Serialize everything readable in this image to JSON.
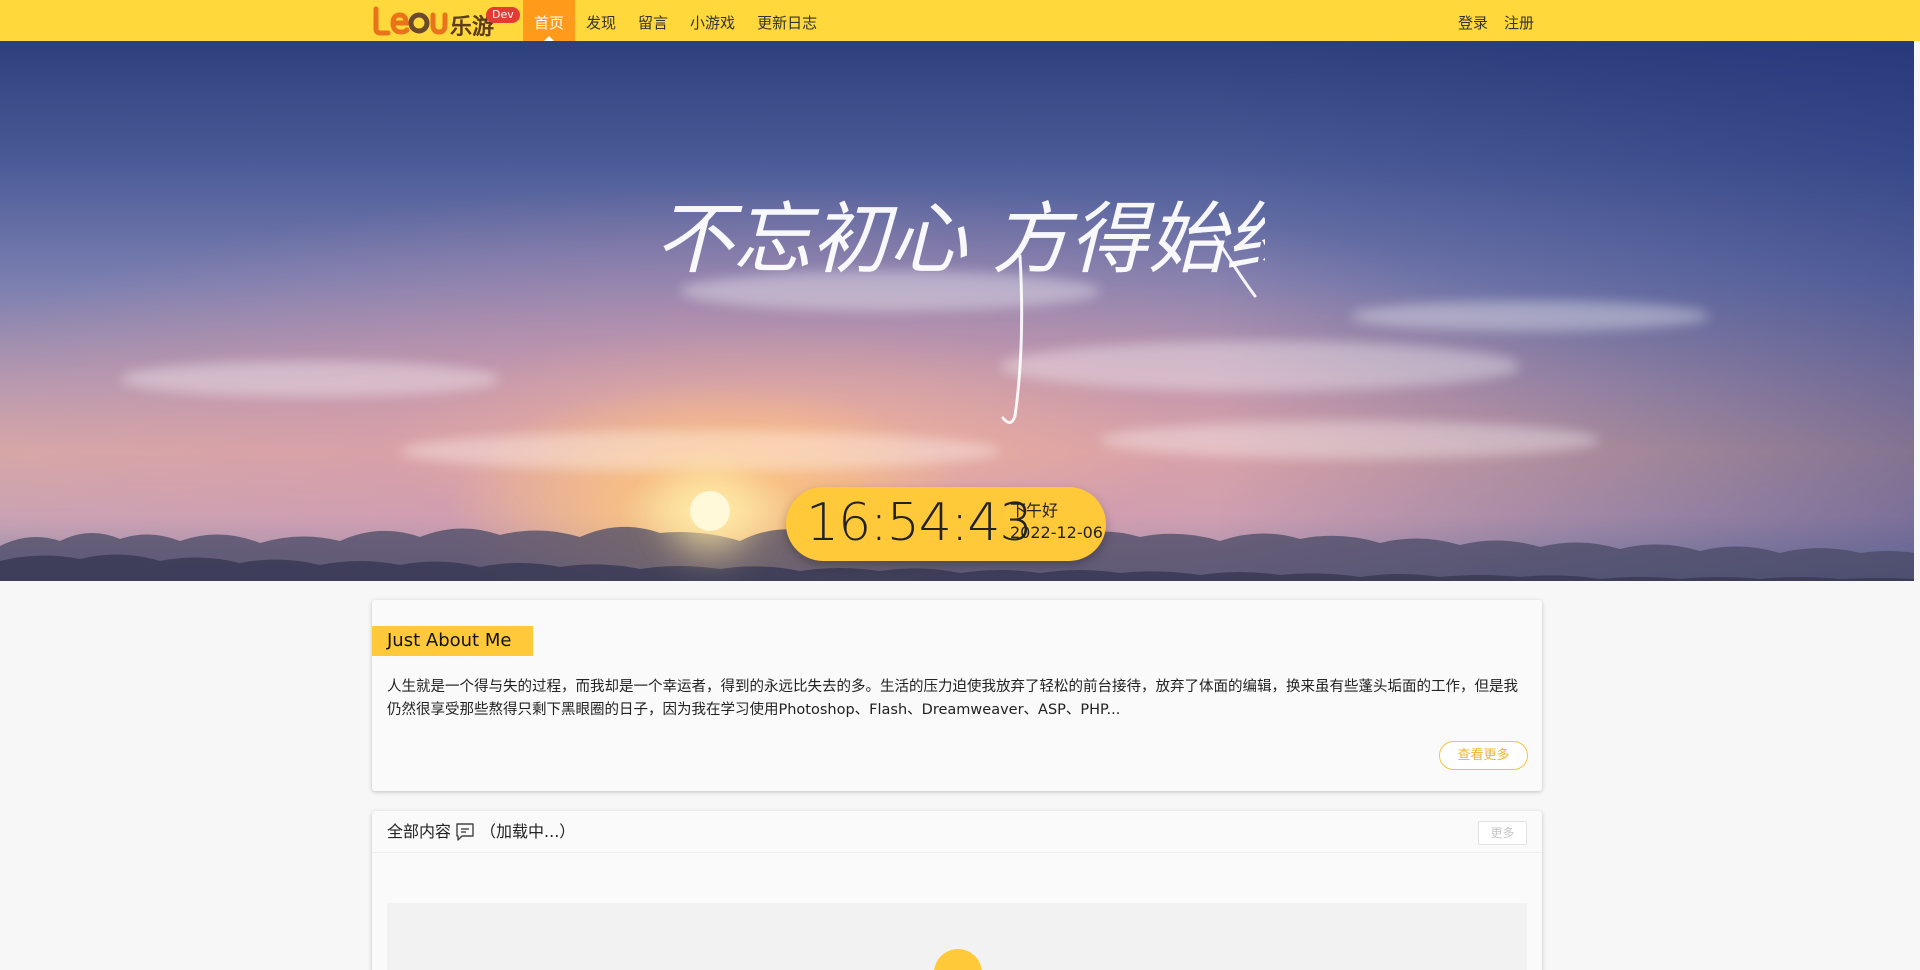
{
  "brand": {
    "logo_text": "leu乐游",
    "badge": "Dev"
  },
  "nav": {
    "items": [
      {
        "label": "首页",
        "active": true
      },
      {
        "label": "发现",
        "active": false
      },
      {
        "label": "留言",
        "active": false
      },
      {
        "label": "小游戏",
        "active": false
      },
      {
        "label": "更新日志",
        "active": false
      }
    ],
    "login": "登录",
    "register": "注册"
  },
  "hero": {
    "slogan": "不忘初心 方得始终",
    "clock_time": "16:54:43",
    "greeting": "下午好",
    "date": "2022-12-06"
  },
  "about": {
    "title": "Just About Me",
    "text": "人生就是一个得与失的过程，而我却是一个幸运者，得到的永远比失去的多。生活的压力迫使我放弃了轻松的前台接待，放弃了体面的编辑，换来虽有些蓬头垢面的工作，但是我仍然很享受那些熬得只剩下黑眼圈的日子，因为我在学习使用Photoshop、Flash、Dreamweaver、ASP、PHP...",
    "more_label": "查看更多"
  },
  "content": {
    "title": "全部内容",
    "status": "（加载中...）",
    "more_label": "更多"
  },
  "colors": {
    "topbar": "#ffd83c",
    "accent_yellow": "#ffc93a",
    "active_nav": "#ff9a1a",
    "badge": "#e53935"
  }
}
